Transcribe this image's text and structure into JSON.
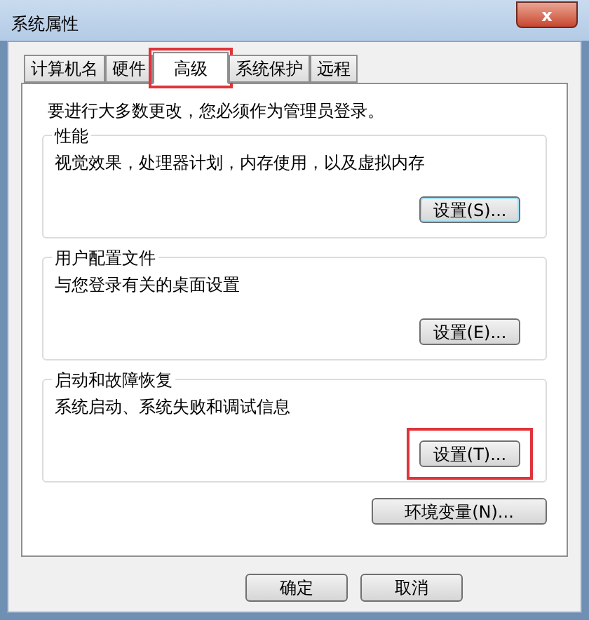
{
  "window": {
    "title": "系统属性",
    "close": "x"
  },
  "tabs": [
    {
      "label": "计算机名",
      "selected": false,
      "highlighted": false
    },
    {
      "label": "硬件",
      "selected": false,
      "highlighted": false
    },
    {
      "label": "高级",
      "selected": true,
      "highlighted": true
    },
    {
      "label": "系统保护",
      "selected": false,
      "highlighted": false
    },
    {
      "label": "远程",
      "selected": false,
      "highlighted": false
    }
  ],
  "notice": "要进行大多数更改，您必须作为管理员登录。",
  "groups": [
    {
      "title": "性能",
      "description": "视觉效果，处理器计划，内存使用，以及虚拟内存",
      "button": "设置(S)...",
      "focused": true,
      "highlighted": false
    },
    {
      "title": "用户配置文件",
      "description": "与您登录有关的桌面设置",
      "button": "设置(E)...",
      "focused": false,
      "highlighted": false
    },
    {
      "title": "启动和故障恢复",
      "description": "系统启动、系统失败和调试信息",
      "button": "设置(T)...",
      "focused": false,
      "highlighted": true
    }
  ],
  "env_button": "环境变量(N)...",
  "footer_buttons": [
    "确定",
    "取消"
  ]
}
